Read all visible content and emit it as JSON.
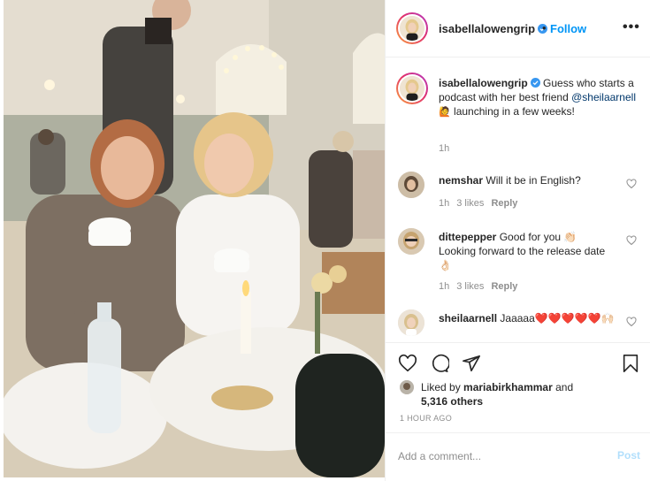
{
  "post": {
    "username": "isabellalowengrip",
    "follow_separator": "•",
    "follow_label": "Follow",
    "more_label": "•••"
  },
  "caption": {
    "username": "isabellalowengrip",
    "text_before_mention": "Guess who starts a podcast with her best friend",
    "mention": "@sheilaarnell",
    "emoji": "🙋",
    "text_after_mention": "launching in a few weeks!",
    "time": "1h"
  },
  "comments": [
    {
      "username": "nemshar",
      "text": "Will it be in English?",
      "time": "1h",
      "likes": "3 likes",
      "reply": "Reply",
      "avatar_color": "#7a6a55"
    },
    {
      "username": "dittepepper",
      "text": "Good for you 👏🏻 Looking forward to the release date 👌🏻",
      "time": "1h",
      "likes": "3 likes",
      "reply": "Reply",
      "avatar_color": "#c9a98a"
    },
    {
      "username": "sheilaarnell",
      "text": "Jaaaaa❤️❤️❤️❤️❤️🙌🏻",
      "avatar_color": "#e8d9c4"
    }
  ],
  "likes": {
    "prefix": "Liked by",
    "user": "mariabirkhammar",
    "conjunction": "and",
    "others": "5,316 others"
  },
  "time_ago": "1 HOUR AGO",
  "add_comment": {
    "placeholder": "Add a comment...",
    "post_label": "Post"
  },
  "colors": {
    "accent": "#0095f6",
    "mention": "#00376b",
    "muted": "#8e8e8e",
    "border": "#efefef"
  },
  "icons": {
    "verified": "verified-badge-icon",
    "like": "heart-icon",
    "comment": "comment-icon",
    "share": "share-icon",
    "save": "bookmark-icon"
  }
}
